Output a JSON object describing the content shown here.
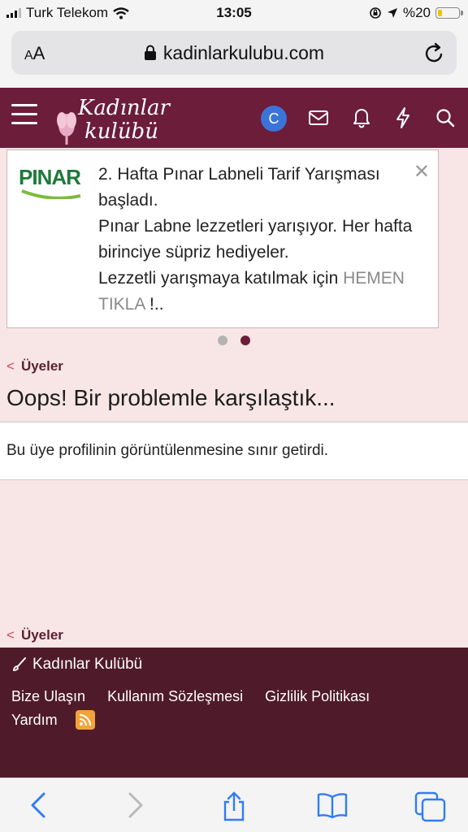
{
  "status_bar": {
    "carrier": "Turk Telekom",
    "time": "13:05",
    "battery": "%20",
    "battery_level": 0.2
  },
  "browser": {
    "text_size_label": "AA",
    "url": "kadinlarkulubu.com"
  },
  "site_header": {
    "logo_line1": "Kadınlar",
    "logo_line2": "kulübü",
    "avatar_initial": "C"
  },
  "notice": {
    "brand": "PINAR",
    "line1": "2. Hafta Pınar Labneli Tarif Yarışması başladı.",
    "line2": "Pınar Labne lezzetleri yarışıyor. Her hafta birinciye süpriz hediyeler.",
    "line3_prefix": "Lezzetli yarışmaya katılmak için ",
    "line3_link": "HEMEN TIKLA",
    "line3_suffix": " !..",
    "close": "✕"
  },
  "carousel": {
    "total": 2,
    "active_index": 1,
    "inactive_color": "#b3b3b3",
    "active_color": "#6b1d39"
  },
  "breadcrumb_top": "Üyeler",
  "page_title": "Oops! Bir problemle karşılaştık...",
  "message": "Bu üye profilinin görüntülenmesine sınır getirdi.",
  "breadcrumb_bottom": "Üyeler",
  "footer": {
    "site_name": "Kadınlar Kulübü",
    "links": [
      "Bize Ulaşın",
      "Kullanım Sözleşmesi",
      "Gizlilik Politikası"
    ],
    "help": "Yardım"
  },
  "colors": {
    "header_bg": "#6b1d39",
    "footer_bg": "#4f1b2a",
    "page_bg": "#f8e6e6",
    "ios_blue": "#2f7cf6"
  },
  "icons": {
    "header": [
      "hamburger-menu-icon",
      "mail-icon",
      "bell-icon",
      "bolt-icon",
      "search-icon"
    ],
    "toolbar": [
      "back-icon",
      "forward-icon",
      "share-icon",
      "bookmarks-icon",
      "tabs-icon"
    ]
  }
}
